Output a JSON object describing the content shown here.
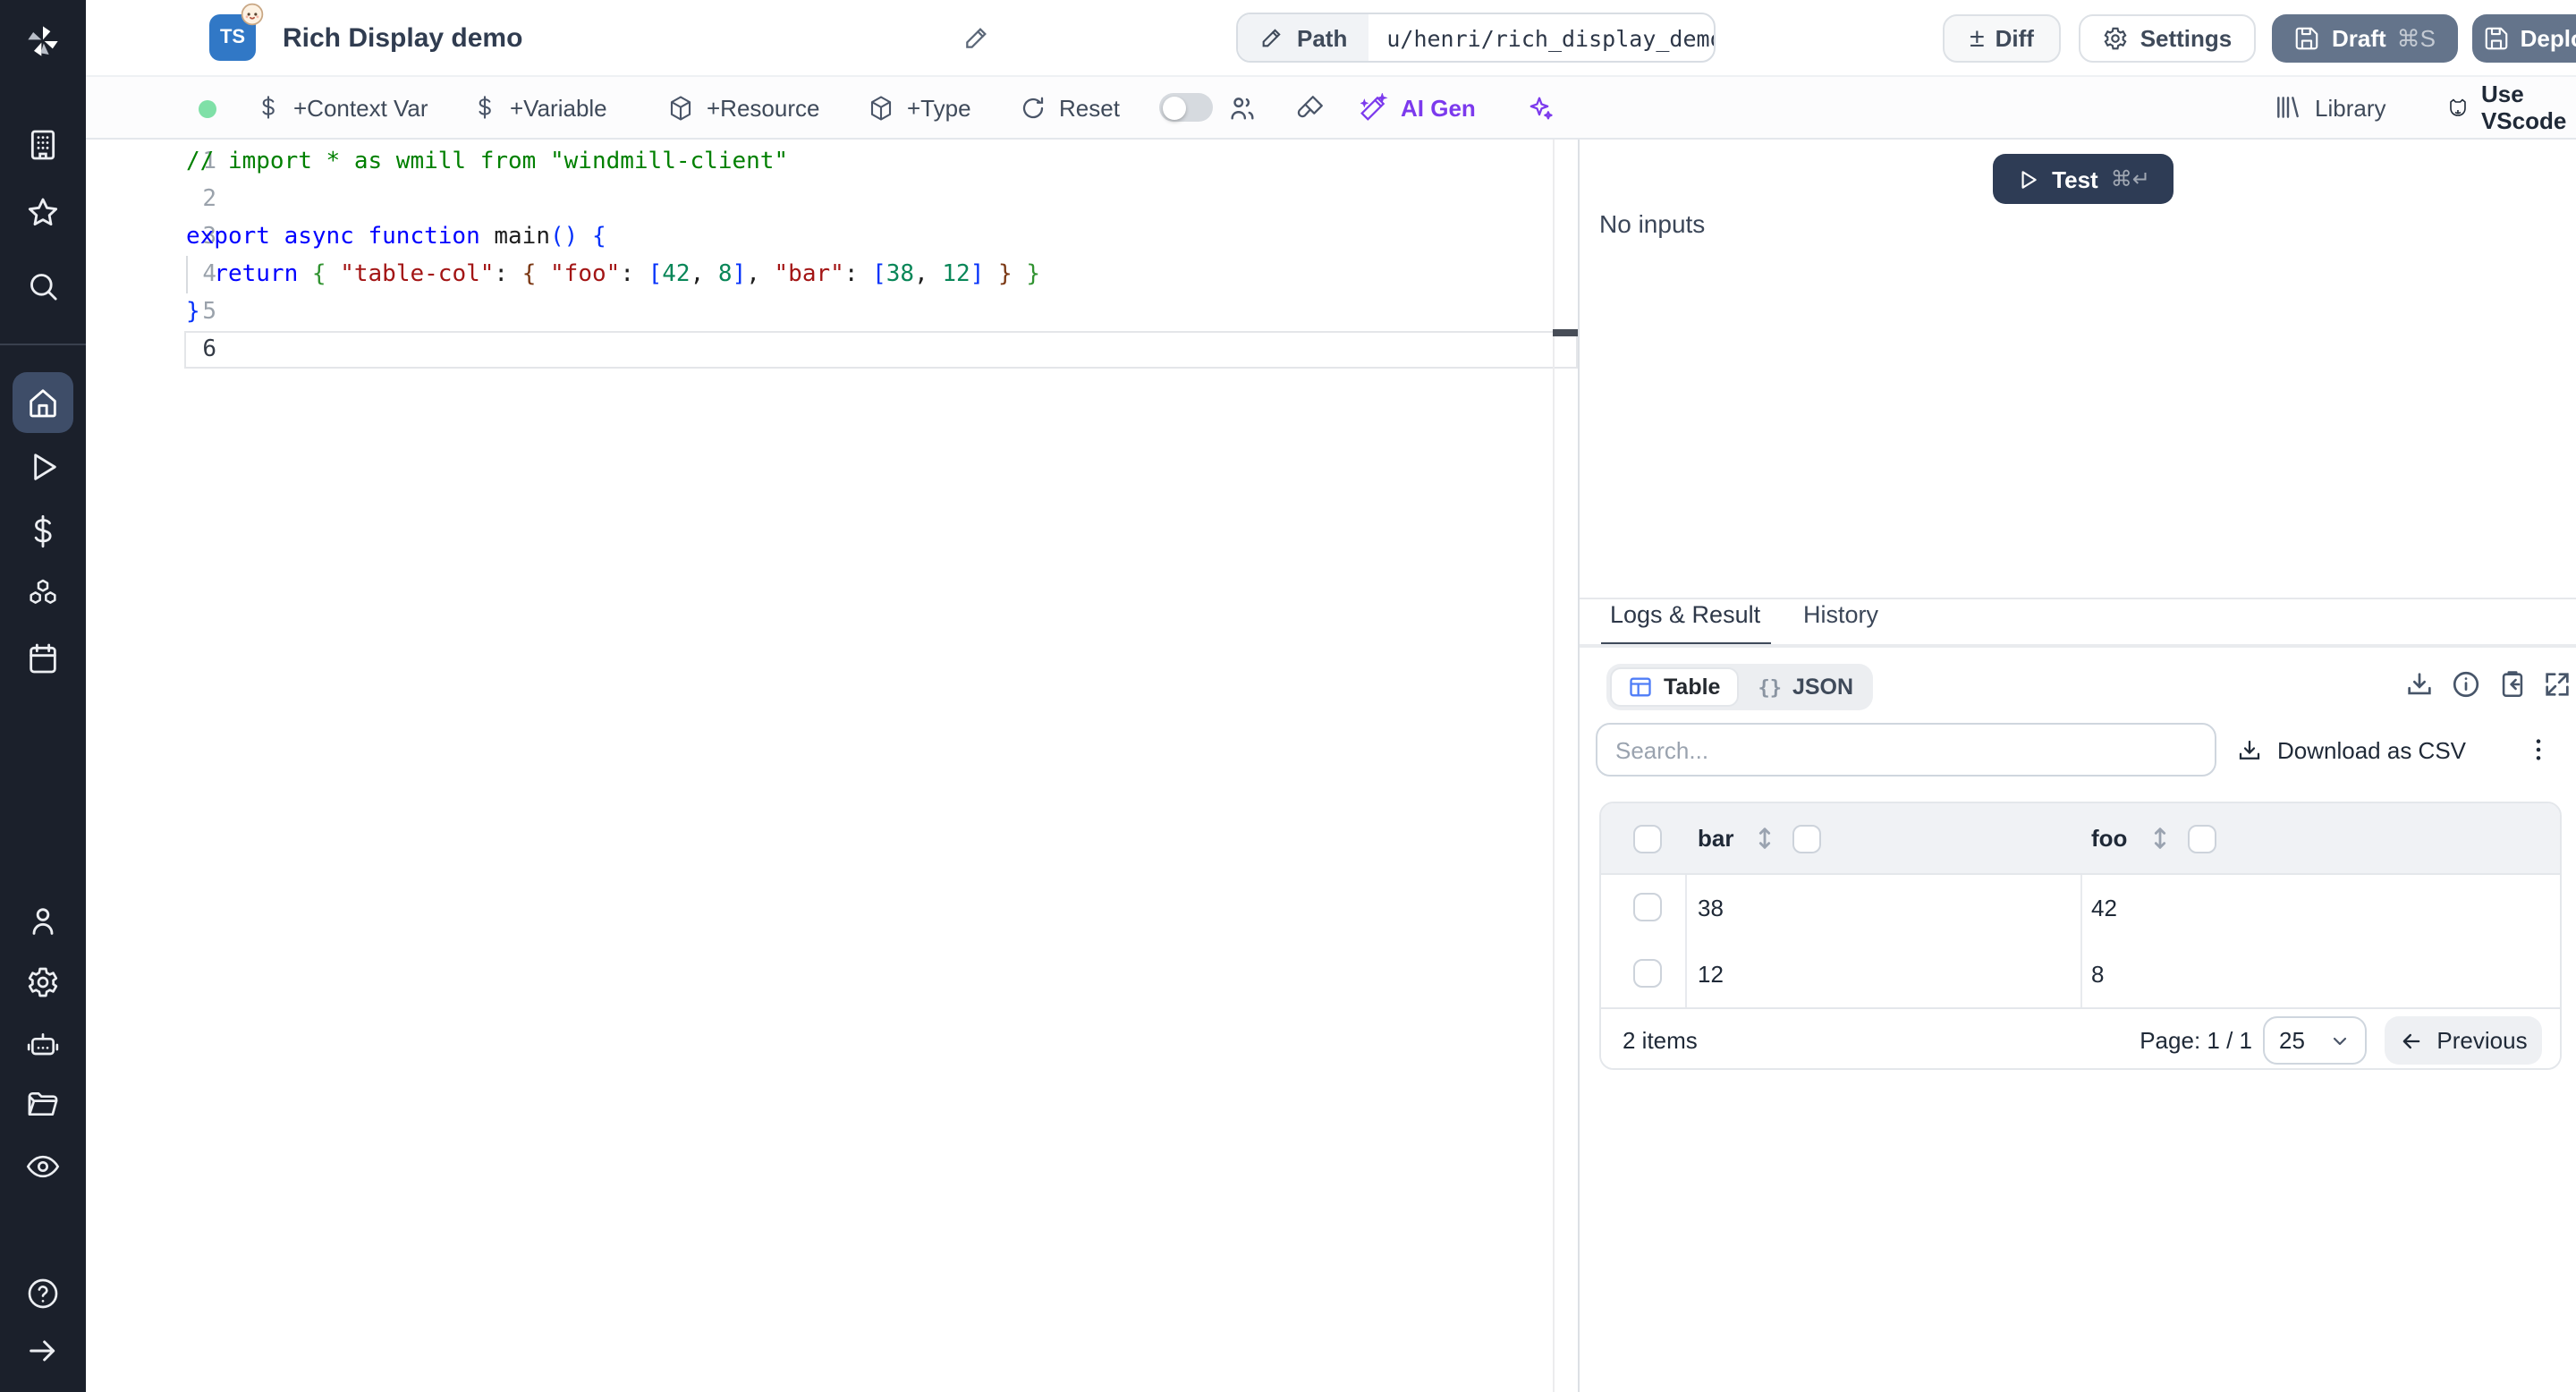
{
  "header": {
    "lang_badge": "TS",
    "title": "Rich Display demo",
    "path_label": "Path",
    "path_value": "u/henri/rich_display_demo",
    "diff_icon": "±",
    "diff": "Diff",
    "settings": "Settings",
    "draft": "Draft",
    "draft_kbd": "⌘S",
    "deploy": "Deploy"
  },
  "toolbar": {
    "context_var": "+Context Var",
    "variable": "+Variable",
    "resource": "+Resource",
    "type": "+Type",
    "reset": "Reset",
    "ai_gen": "AI Gen",
    "library": "Library",
    "vscode": "Use VScode"
  },
  "editor": {
    "line_numbers": [
      "1",
      "2",
      "3",
      "4",
      "5",
      "6"
    ],
    "code": {
      "l1": [
        "// import * as wmill from \"windmill-client\""
      ],
      "l3": [
        "export async function ",
        "main",
        "(",
        ") ",
        "{"
      ],
      "l4": [
        "  return ",
        "{",
        " ",
        "\"table-col\"",
        ": ",
        "{",
        " ",
        "\"foo\"",
        ": ",
        "[",
        "42",
        ", ",
        "8",
        "]",
        ", ",
        "\"bar\"",
        ": ",
        "[",
        "38",
        ", ",
        "12",
        "]",
        " ",
        "}",
        " ",
        "}"
      ],
      "l5": [
        "}"
      ]
    }
  },
  "run_panel": {
    "test_label": "Test",
    "test_kbd": "⌘↵",
    "no_inputs": "No inputs"
  },
  "result_panel": {
    "tab_logs": "Logs & Result",
    "tab_history": "History",
    "view_table": "Table",
    "view_json": "JSON",
    "json_icon": "{}",
    "search_placeholder": "Search...",
    "download_csv": "Download as CSV",
    "table": {
      "columns": [
        "bar",
        "foo"
      ],
      "rows": [
        [
          "38",
          "42"
        ],
        [
          "12",
          "8"
        ]
      ],
      "items_count": "2 items",
      "page": "Page: 1 / 1",
      "page_size": "25",
      "prev": "Previous"
    }
  },
  "colors": {
    "accent_purple": "#7c3aed",
    "brand_blue": "#3178c6",
    "slate_button": "#64748b",
    "test_button": "#2e3c55",
    "status_green": "#7fe0a7",
    "sidebar_bg": "#1b202b"
  }
}
